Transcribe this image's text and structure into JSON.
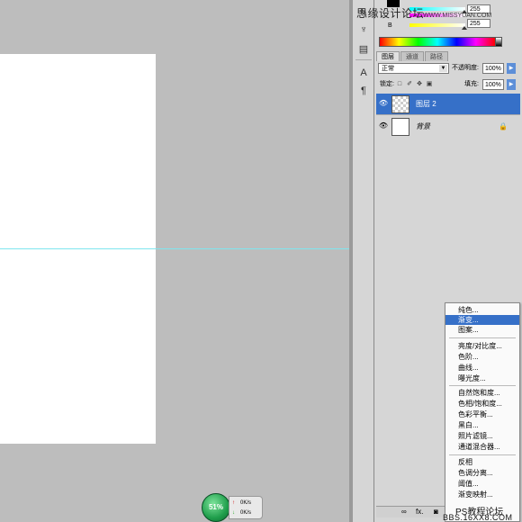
{
  "watermark": {
    "text": "思缘设计论坛",
    "url": "WWW.MISSYUAN.COM"
  },
  "color_panel": {
    "r_value": "255",
    "g_value": "255",
    "b_label": "B"
  },
  "layers_panel": {
    "tabs": [
      "图层",
      "通道",
      "路径"
    ],
    "blend_mode": "正常",
    "opacity_label": "不透明度:",
    "opacity_value": "100%",
    "lock_label": "锁定:",
    "fill_label": "填充:",
    "fill_value": "100%",
    "layers": [
      {
        "name": "图层 2",
        "selected": true
      },
      {
        "name": "背景",
        "selected": false,
        "locked": true
      }
    ],
    "bottom_fx": "fx."
  },
  "adjustment_menu": {
    "items": [
      "纯色...",
      "渐变...",
      "图案...",
      "亮度/对比度...",
      "色阶...",
      "曲线...",
      "曝光度...",
      "自然饱和度...",
      "色相/饱和度...",
      "色彩平衡...",
      "黑白...",
      "照片滤镜...",
      "通道混合器...",
      "反相",
      "色调分离...",
      "阈值...",
      "渐变映射..."
    ],
    "highlighted_index": 1
  },
  "network_widget": {
    "percent": "51%",
    "up": "0K/s",
    "down": "0K/s"
  },
  "forum_watermark": {
    "line1": "PS教程论坛",
    "line2": "BBS.16XX8.COM"
  },
  "icons": {
    "eye": "eye-icon",
    "lock": "lock-icon",
    "fx": "fx-icon"
  }
}
